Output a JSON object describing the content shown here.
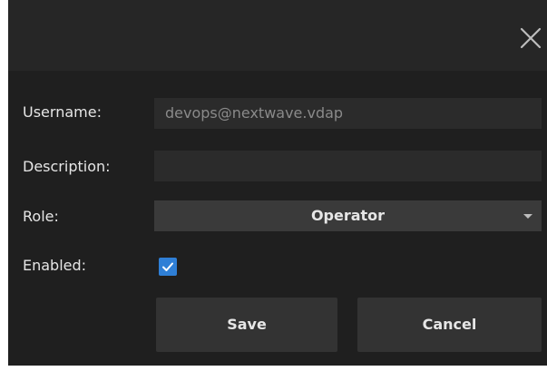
{
  "dialog": {
    "close_icon": "close-icon",
    "fields": {
      "username": {
        "label": "Username:",
        "value": "devops@nextwave.vdap"
      },
      "description": {
        "label": "Description:",
        "value": ""
      },
      "role": {
        "label": "Role:",
        "selected": "Operator"
      },
      "enabled": {
        "label": "Enabled:",
        "checked": true
      }
    },
    "buttons": {
      "save": "Save",
      "cancel": "Cancel"
    },
    "colors": {
      "background": "#1f1f1f",
      "titlebar": "#262626",
      "field": "#2b2b2b",
      "accent": "#2f7fd6"
    }
  }
}
